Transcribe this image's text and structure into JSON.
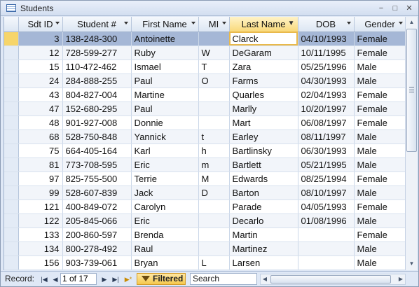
{
  "window": {
    "title": "Students",
    "controls": [
      "−",
      "□",
      "✕"
    ]
  },
  "table": {
    "columns": [
      "Sdt ID",
      "Student #",
      "First Name",
      "MI",
      "Last Name",
      "DOB",
      "Gender"
    ],
    "sorted_filtered_column": "Last Name",
    "current_row_index": 0,
    "editing_value": "Clarck",
    "rows": [
      [
        "3",
        "138-248-300",
        "Antoinette",
        "",
        "Clarck",
        "04/10/1993",
        "Female"
      ],
      [
        "12",
        "728-599-277",
        "Ruby",
        "W",
        "DeGaram",
        "10/11/1995",
        "Female"
      ],
      [
        "15",
        "110-472-462",
        "Ismael",
        "T",
        "Zara",
        "05/25/1996",
        "Male"
      ],
      [
        "24",
        "284-888-255",
        "Paul",
        "O",
        "Farms",
        "04/30/1993",
        "Male"
      ],
      [
        "43",
        "804-827-004",
        "Martine",
        "",
        "Quarles",
        "02/04/1993",
        "Female"
      ],
      [
        "47",
        "152-680-295",
        "Paul",
        "",
        "Marlly",
        "10/20/1997",
        "Female"
      ],
      [
        "48",
        "901-927-008",
        "Donnie",
        "",
        "Mart",
        "06/08/1997",
        "Female"
      ],
      [
        "68",
        "528-750-848",
        "Yannick",
        "t",
        "Earley",
        "08/11/1997",
        "Male"
      ],
      [
        "75",
        "664-405-164",
        "Karl",
        "h",
        "Bartlinsky",
        "06/30/1993",
        "Male"
      ],
      [
        "81",
        "773-708-595",
        "Eric",
        "m",
        "Bartlett",
        "05/21/1995",
        "Male"
      ],
      [
        "97",
        "825-755-500",
        "Terrie",
        "M",
        "Edwards",
        "08/25/1994",
        "Female"
      ],
      [
        "99",
        "528-607-839",
        "Jack",
        "D",
        "Barton",
        "08/10/1997",
        "Male"
      ],
      [
        "121",
        "400-849-072",
        "Carolyn",
        "",
        "Parade",
        "04/05/1993",
        "Female"
      ],
      [
        "122",
        "205-845-066",
        "Eric",
        "",
        "Decarlo",
        "01/08/1996",
        "Male"
      ],
      [
        "133",
        "200-860-597",
        "Brenda",
        "",
        "Martin",
        "",
        "Female"
      ],
      [
        "134",
        "800-278-492",
        "Raul",
        "",
        "Martinez",
        "",
        "Male"
      ],
      [
        "156",
        "903-739-061",
        "Bryan",
        "L",
        "Larsen",
        "",
        "Male"
      ]
    ]
  },
  "statusbar": {
    "record_label": "Record:",
    "record_value": "1 of 17",
    "filter_label": "Filtered",
    "search_placeholder": "Search",
    "nav_icons": [
      "first-record-icon",
      "previous-record-icon",
      "next-record-icon",
      "last-record-icon",
      "new-record-icon"
    ]
  },
  "colors": {
    "current_row": "#a5b7d6",
    "filtered_header": "#f9d97a",
    "record_selector_current": "#f6d56b"
  }
}
